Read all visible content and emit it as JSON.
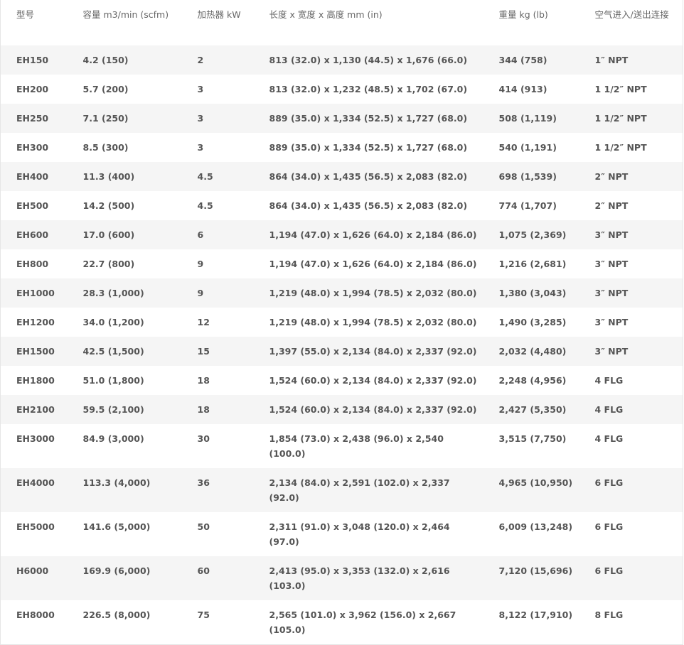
{
  "table": {
    "headers": [
      "型号",
      "容量 m3/min (scfm)",
      "加热器 kW",
      "长度 x 宽度 x 高度 mm (in)",
      "重量 kg (lb)",
      "空气进入/送出连接"
    ],
    "rows": [
      [
        "EH150",
        "4.2 (150)",
        "2",
        "813 (32.0) x 1,130 (44.5) x 1,676 (66.0)",
        "344 (758)",
        "1″ NPT"
      ],
      [
        "EH200",
        "5.7 (200)",
        "3",
        "813 (32.0) x 1,232 (48.5) x 1,702 (67.0)",
        "414 (913)",
        "1 1/2″ NPT"
      ],
      [
        "EH250",
        "7.1 (250)",
        "3",
        "889 (35.0) x 1,334 (52.5) x 1,727 (68.0)",
        "508 (1,119)",
        "1 1/2″ NPT"
      ],
      [
        "EH300",
        "8.5 (300)",
        "3",
        "889 (35.0) x 1,334 (52.5) x 1,727 (68.0)",
        "540 (1,191)",
        "1 1/2″ NPT"
      ],
      [
        "EH400",
        "11.3 (400)",
        "4.5",
        "864 (34.0) x 1,435 (56.5) x 2,083 (82.0)",
        "698 (1,539)",
        "2″ NPT"
      ],
      [
        "EH500",
        "14.2 (500)",
        "4.5",
        "864 (34.0) x 1,435 (56.5) x 2,083 (82.0)",
        "774 (1,707)",
        "2″ NPT"
      ],
      [
        "EH600",
        "17.0 (600)",
        "6",
        "1,194 (47.0) x 1,626 (64.0) x 2,184 (86.0)",
        "1,075 (2,369)",
        "3″ NPT"
      ],
      [
        "EH800",
        "22.7 (800)",
        "9",
        "1,194 (47.0) x 1,626 (64.0) x 2,184 (86.0)",
        "1,216 (2,681)",
        "3″ NPT"
      ],
      [
        "EH1000",
        "28.3 (1,000)",
        "9",
        "1,219 (48.0) x 1,994 (78.5) x 2,032 (80.0)",
        "1,380 (3,043)",
        "3″ NPT"
      ],
      [
        "EH1200",
        "34.0 (1,200)",
        "12",
        "1,219 (48.0) x 1,994 (78.5) x 2,032 (80.0)",
        "1,490 (3,285)",
        "3″ NPT"
      ],
      [
        "EH1500",
        "42.5 (1,500)",
        "15",
        "1,397 (55.0) x 2,134 (84.0) x 2,337 (92.0)",
        "2,032 (4,480)",
        "3″ NPT"
      ],
      [
        "EH1800",
        "51.0 (1,800)",
        "18",
        "1,524 (60.0) x 2,134 (84.0) x 2,337 (92.0)",
        "2,248 (4,956)",
        "4 FLG"
      ],
      [
        "EH2100",
        "59.5 (2,100)",
        "18",
        "1,524 (60.0) x 2,134 (84.0) x 2,337 (92.0)",
        "2,427 (5,350)",
        "4 FLG"
      ],
      [
        "EH3000",
        "84.9 (3,000)",
        "30",
        "1,854 (73.0) x 2,438 (96.0) x 2,540 (100.0)",
        "3,515 (7,750)",
        "4 FLG"
      ],
      [
        "EH4000",
        "113.3 (4,000)",
        "36",
        "2,134 (84.0) x 2,591 (102.0) x 2,337 (92.0)",
        "4,965 (10,950)",
        "6 FLG"
      ],
      [
        "EH5000",
        "141.6 (5,000)",
        "50",
        "2,311 (91.0) x 3,048 (120.0) x 2,464 (97.0)",
        "6,009 (13,248)",
        "6 FLG"
      ],
      [
        "H6000",
        "169.9 (6,000)",
        "60",
        "2,413 (95.0) x 3,353 (132.0) x 2,616 (103.0)",
        "7,120 (15,696)",
        "6 FLG"
      ],
      [
        "EH8000",
        "226.5 (8,000)",
        "75",
        "2,565 (101.0) x 3,962 (156.0) x 2,667 (105.0)",
        "8,122 (17,910)",
        "8 FLG"
      ]
    ]
  }
}
